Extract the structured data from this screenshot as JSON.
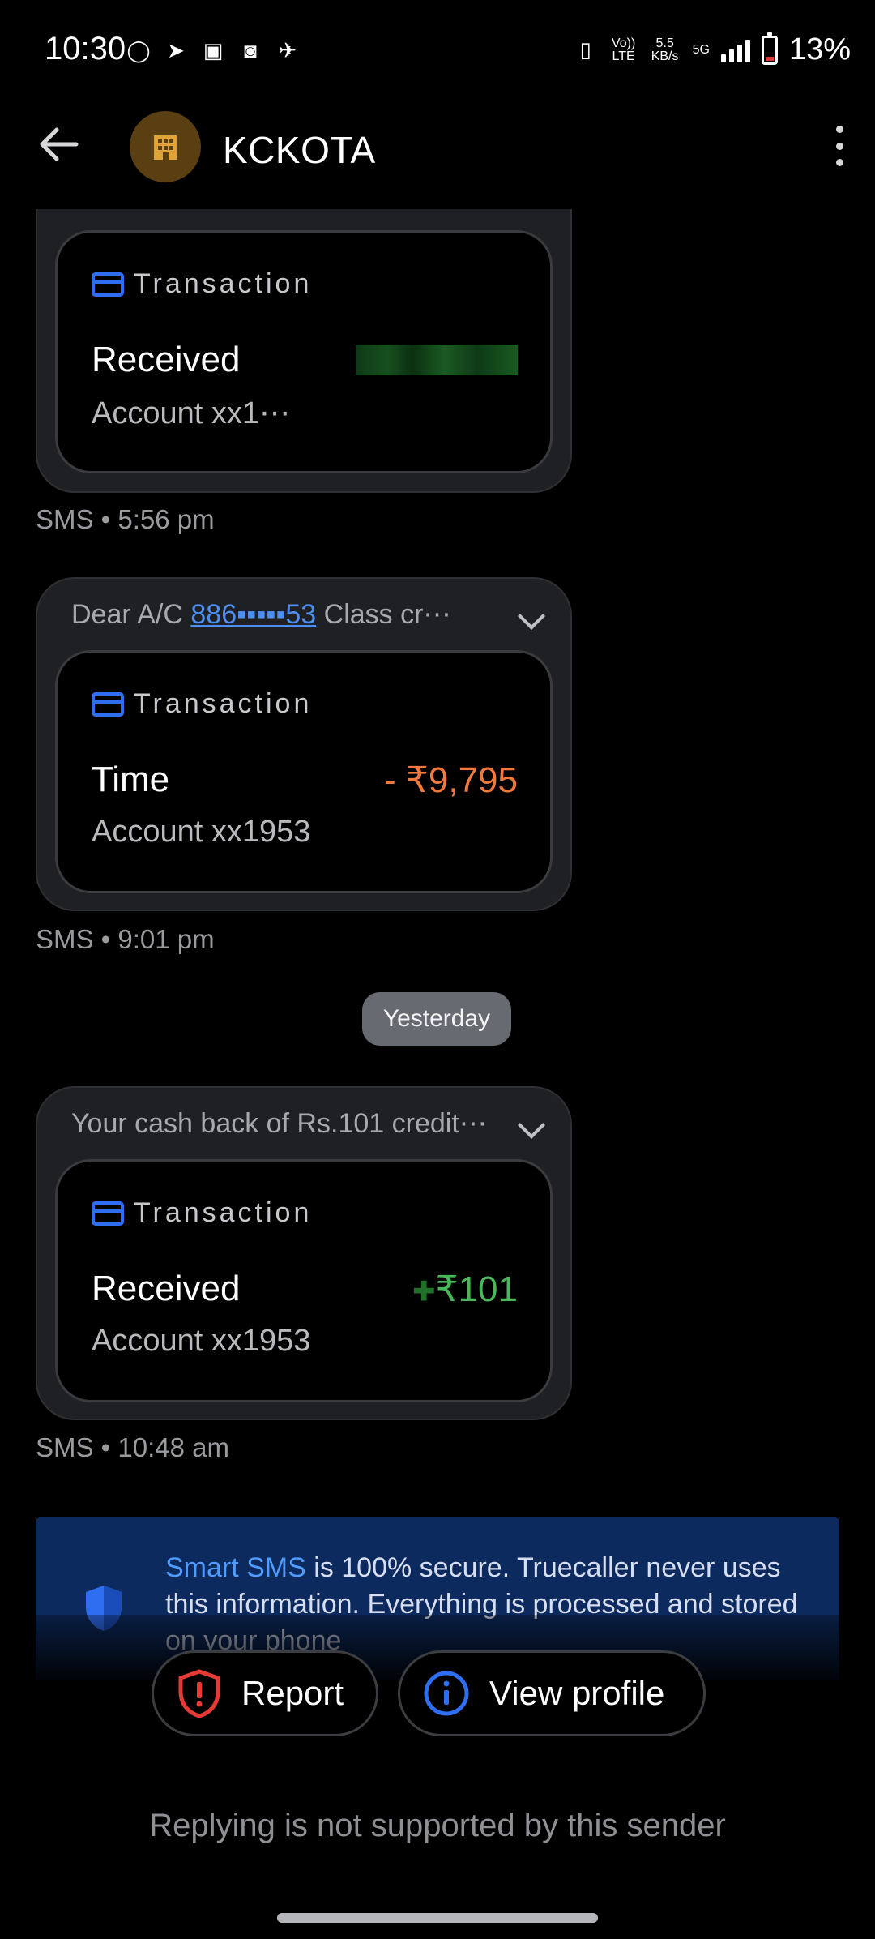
{
  "status_bar": {
    "time": "10:30",
    "volte": "Vo)) LTE",
    "speed": "5.5 KB/s",
    "network": "5G",
    "battery": "13%"
  },
  "header": {
    "sender": "KCKOTA"
  },
  "messages": [
    {
      "card_title": "Transaction",
      "label": "Received",
      "account": "Account xx1⋯",
      "meta": "SMS • 5:56 pm"
    },
    {
      "preview_start": "Dear A/C ",
      "preview_link": "886▪▪▪▪▪53",
      "preview_end": " Class cr⋯",
      "card_title": "Transaction",
      "label": "Time",
      "amount": "- ₹9,795",
      "account": "Account xx1953",
      "meta": "SMS • 9:01 pm"
    },
    {
      "preview": "Your cash back of Rs.101 credit⋯",
      "card_title": "Transaction",
      "label": "Received",
      "amount": "₹101",
      "account": "Account xx1953",
      "meta": "SMS • 10:48 am"
    }
  ],
  "day_divider": "Yesterday",
  "banner": {
    "highlight": "Smart SMS",
    "text": " is 100% secure. Truecaller never uses this information. Everything is processed and stored on your phone"
  },
  "actions": {
    "report": "Report",
    "view_profile": "View profile"
  },
  "reply_note": "Replying is not supported by this sender",
  "colors": {
    "accent_blue": "#2f6ef0",
    "negative": "#f07a3e",
    "positive": "#49b85a",
    "report_red": "#e53935"
  }
}
